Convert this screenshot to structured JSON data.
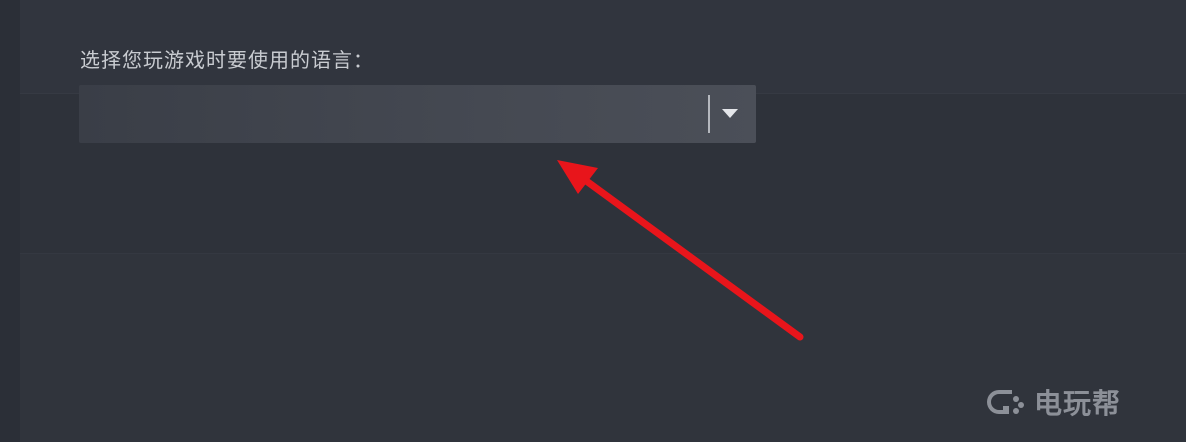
{
  "language_section": {
    "prompt": "选择您玩游戏时要使用的语言：",
    "select": {
      "selected_value": ""
    }
  },
  "annotation": {
    "arrow_color": "#e8151b"
  },
  "watermark": {
    "text": "电玩帮",
    "icon": "gamepad-logo-icon"
  },
  "colors": {
    "background": "#30343d",
    "select_background": "#454952",
    "label_text": "#c9ccd1"
  }
}
